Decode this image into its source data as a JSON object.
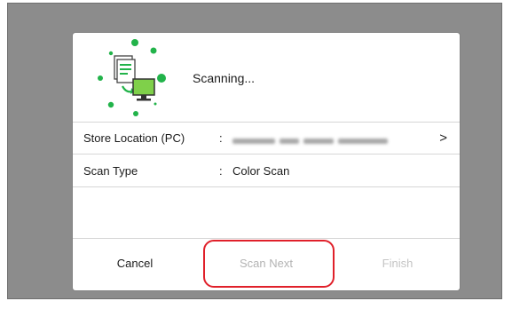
{
  "dialog": {
    "status_text": "Scanning...",
    "status_icon": "scanning-to-pc-icon",
    "rows": [
      {
        "label": "Store Location (PC)",
        "separator": ":",
        "value": "",
        "value_obscured": true,
        "chevron": ">"
      },
      {
        "label": "Scan Type",
        "separator": ":",
        "value": "Color Scan"
      }
    ],
    "buttons": {
      "cancel": "Cancel",
      "scan_next": "Scan Next",
      "finish": "Finish"
    }
  },
  "colors": {
    "screen_background": "#8c8c8c",
    "dot_green": "#22b34a",
    "highlight_red": "#e0202a",
    "disabled_text": "#b3b3b3"
  }
}
